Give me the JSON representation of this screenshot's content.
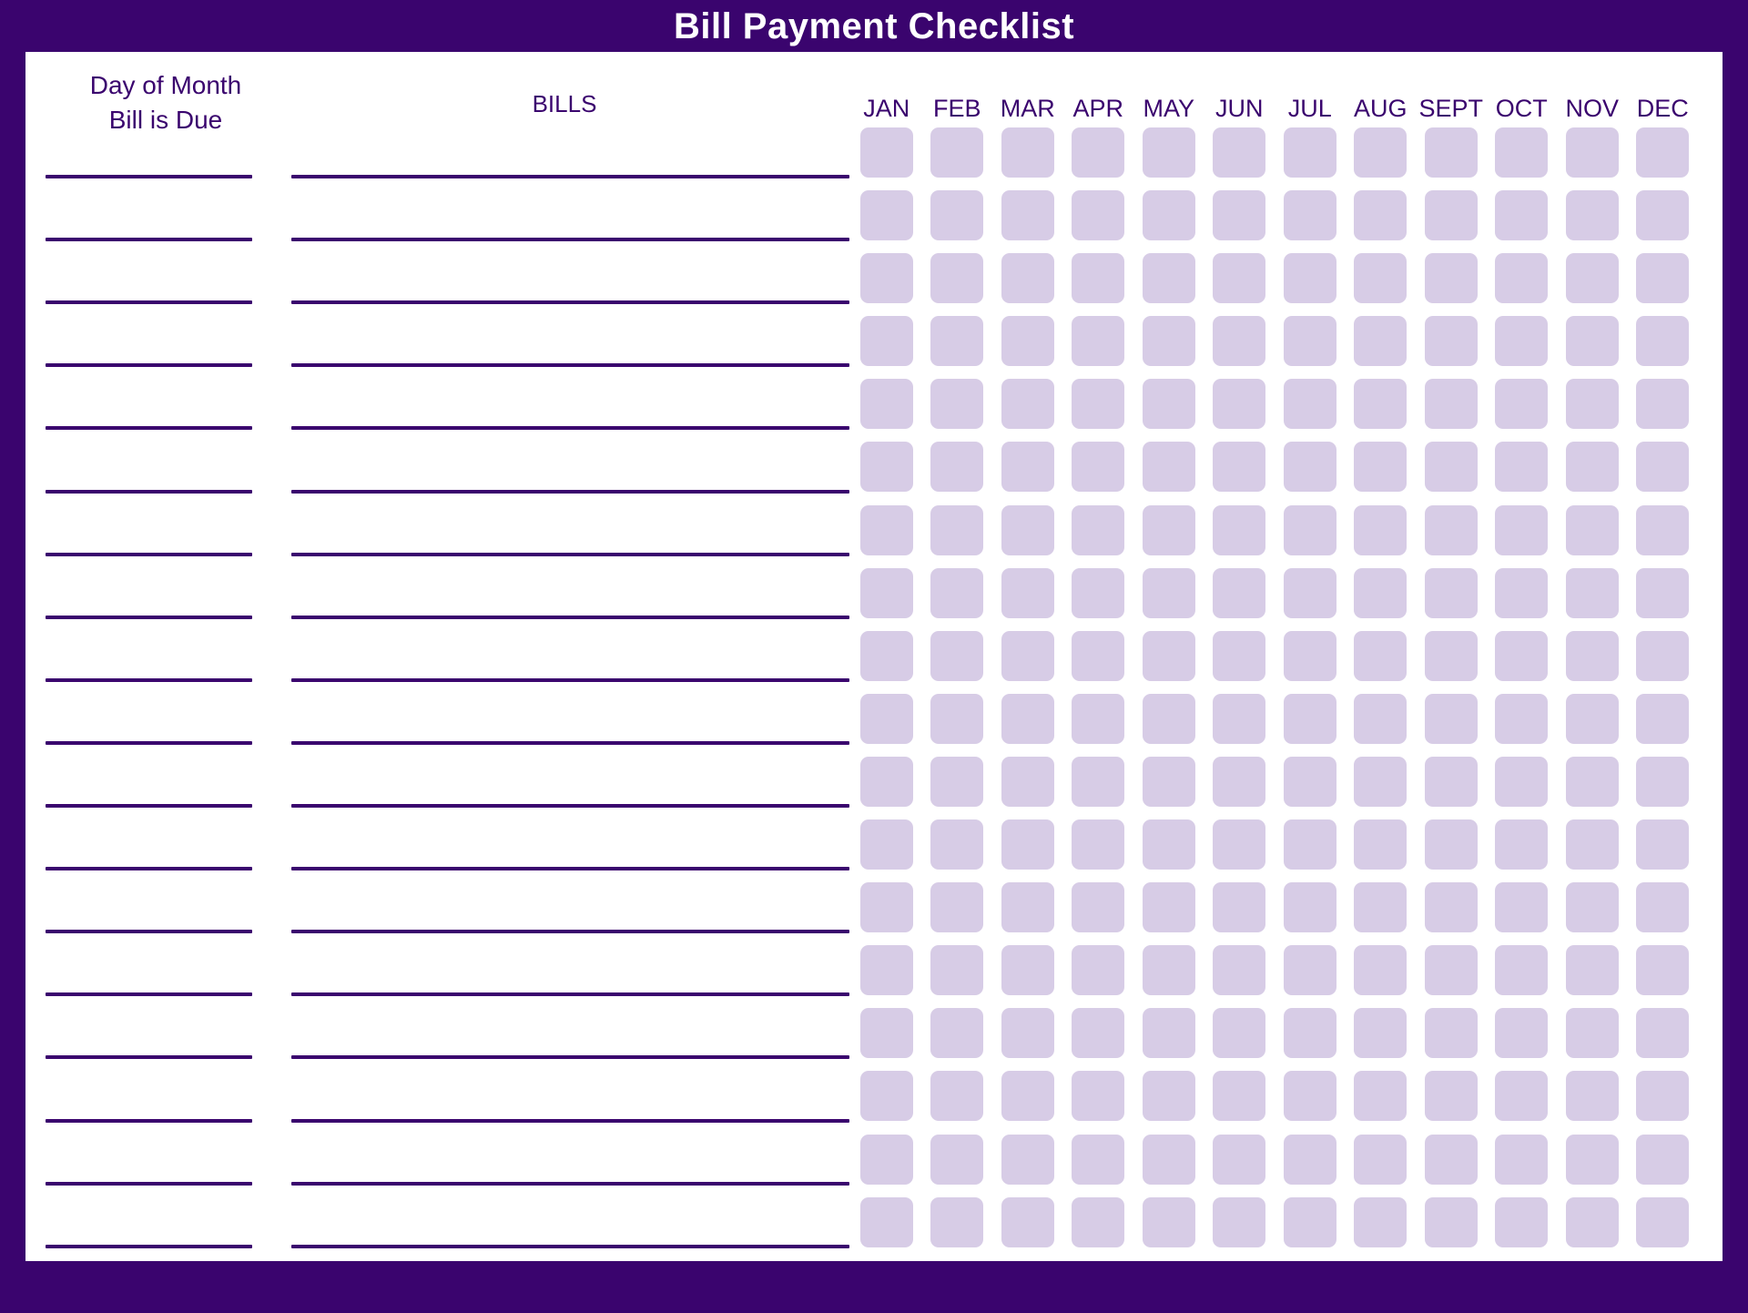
{
  "document": {
    "title": "Bill Payment Checklist",
    "colors": {
      "background_purple": "#3a046e",
      "sheet_white": "#ffffff",
      "checkbox_lavender": "#d7cce6",
      "rule_purple": "#3a046e",
      "title_text": "#ffffff"
    }
  },
  "headers": {
    "day_of_month_line1": "Day of Month",
    "day_of_month_line2": "Bill is Due",
    "bills": "BILLS"
  },
  "months": [
    "JAN",
    "FEB",
    "MAR",
    "APR",
    "MAY",
    "JUN",
    "JUL",
    "AUG",
    "SEPT",
    "OCT",
    "NOV",
    "DEC"
  ],
  "grid": {
    "row_count": 18,
    "column_count": 12,
    "day_entry_value": "",
    "bill_entry_value": "",
    "checkbox_state": "unchecked"
  },
  "rows": [
    {
      "day_due": "",
      "bill_name": ""
    },
    {
      "day_due": "",
      "bill_name": ""
    },
    {
      "day_due": "",
      "bill_name": ""
    },
    {
      "day_due": "",
      "bill_name": ""
    },
    {
      "day_due": "",
      "bill_name": ""
    },
    {
      "day_due": "",
      "bill_name": ""
    },
    {
      "day_due": "",
      "bill_name": ""
    },
    {
      "day_due": "",
      "bill_name": ""
    },
    {
      "day_due": "",
      "bill_name": ""
    },
    {
      "day_due": "",
      "bill_name": ""
    },
    {
      "day_due": "",
      "bill_name": ""
    },
    {
      "day_due": "",
      "bill_name": ""
    },
    {
      "day_due": "",
      "bill_name": ""
    },
    {
      "day_due": "",
      "bill_name": ""
    },
    {
      "day_due": "",
      "bill_name": ""
    },
    {
      "day_due": "",
      "bill_name": ""
    },
    {
      "day_due": "",
      "bill_name": ""
    },
    {
      "day_due": "",
      "bill_name": ""
    }
  ]
}
